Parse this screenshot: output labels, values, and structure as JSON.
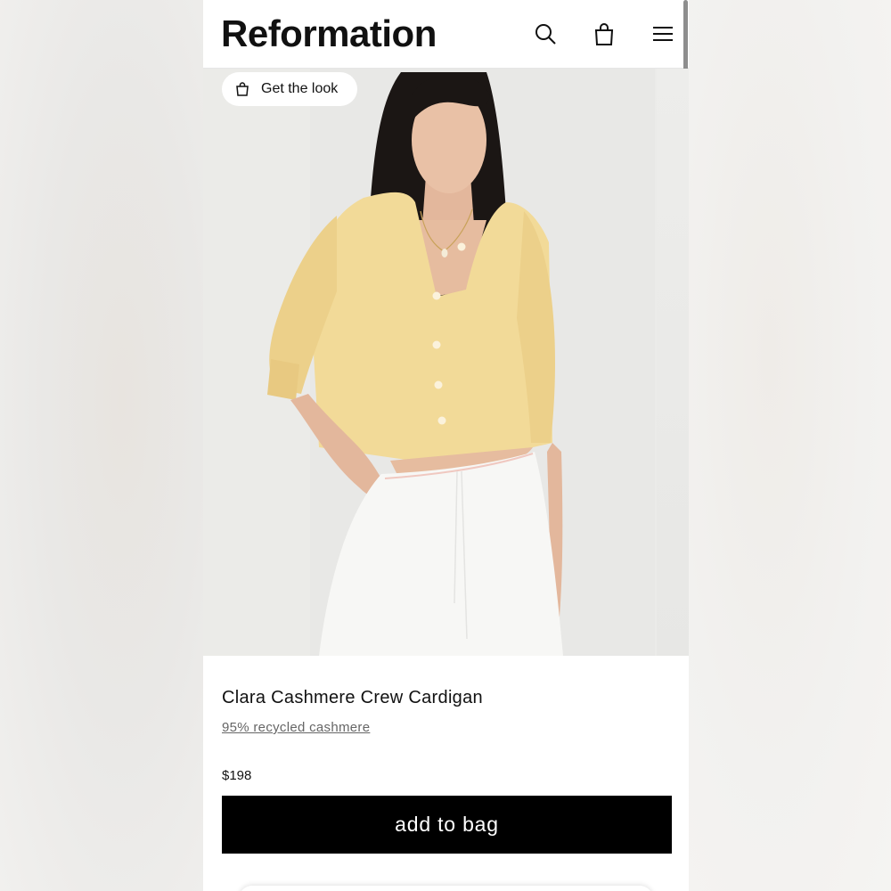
{
  "header": {
    "logo": "Reformation",
    "icons": [
      "search-icon",
      "bag-icon",
      "menu-icon"
    ]
  },
  "gallery": {
    "get_the_look_label": "Get the look"
  },
  "product": {
    "name": "Clara Cashmere Crew Cardigan",
    "material": "95% recycled cashmere",
    "price": "$198",
    "add_to_bag_label": "add to bag"
  },
  "colors": {
    "accent": "#000000",
    "sweater": "#f2da98",
    "skirt": "#f7f7f5",
    "background": "#ffffff"
  }
}
